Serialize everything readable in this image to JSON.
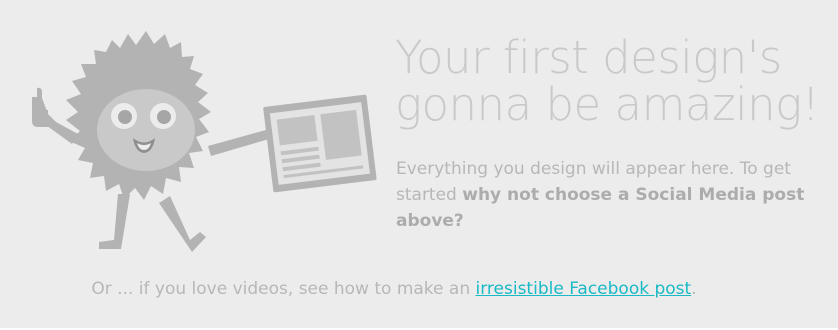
{
  "empty_state": {
    "headline": "Your first design's gonna be amazing!",
    "description_text": "Everything you design will appear here. To get started ",
    "description_bold": "why not choose a Social Media post above?",
    "footer_text": "Or ... if you love videos, see how to make an ",
    "footer_link": "irresistible Facebook post",
    "footer_end": "."
  },
  "illustration": {
    "icon": "fuzzy-monster-holding-design-icon"
  },
  "colors": {
    "background": "#ececec",
    "muted_text": "#b7b7b7",
    "headline": "#c9c9c9",
    "link": "#19b9c5",
    "mascot_fur": "#b3b3b3"
  }
}
